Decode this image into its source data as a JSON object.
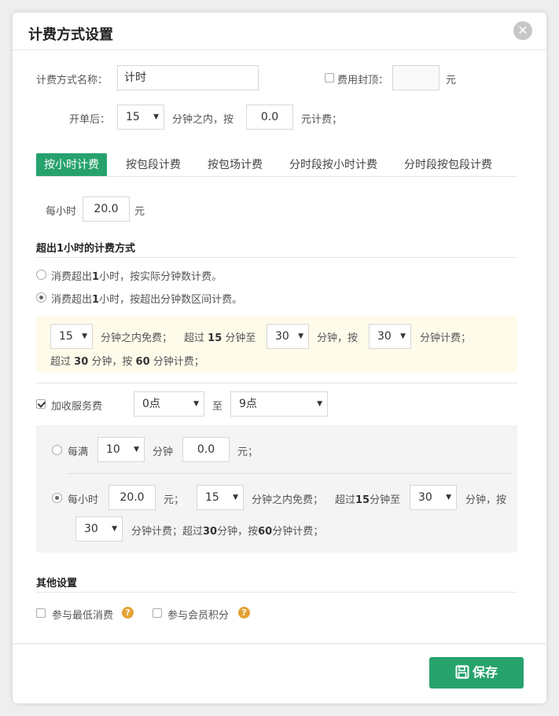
{
  "dialog": {
    "title": "计费方式设置",
    "close_icon": "✕"
  },
  "form": {
    "name_label": "计费方式名称：",
    "name_value": "计时",
    "cap_label": "费用封顶：",
    "cap_value": "",
    "cap_unit": "元",
    "cap_checked": false,
    "open_label": "开单后：",
    "open_minutes": "15",
    "open_within": "分钟之内，按",
    "open_fee": "0.0",
    "open_unit": "元计费；"
  },
  "tabs": [
    {
      "label": "按小时计费",
      "active": true
    },
    {
      "label": "按包段计费",
      "active": false
    },
    {
      "label": "按包场计费",
      "active": false
    },
    {
      "label": "分时段按小时计费",
      "active": false
    },
    {
      "label": "分时段按包段计费",
      "active": false
    }
  ],
  "hourly": {
    "label": "每小时",
    "value": "20.0",
    "unit": "元"
  },
  "overtime": {
    "title": "超出1小时的计费方式",
    "option1": {
      "pre": "消费超出",
      "num": "1",
      "post": "小时，按实际分钟数计费。",
      "selected": false
    },
    "option2": {
      "pre": "消费超出",
      "num": "1",
      "post": "小时，按超出分钟数区间计费。",
      "selected": true
    },
    "box": {
      "free_minutes": "15",
      "free_text": "分钟之内免费；",
      "over_pre": "超过",
      "over_num": "15",
      "over_mid": "分钟至",
      "to_minutes": "30",
      "per_text": "分钟，按",
      "charge_minutes": "30",
      "charge_text": "分钟计费；",
      "line2_pre": "超过",
      "line2_num1": "30",
      "line2_mid": "分钟，按",
      "line2_num2": "60",
      "line2_post": "分钟计费；"
    }
  },
  "service": {
    "checked": true,
    "label": "加收服务费",
    "from": "0点",
    "to_label": "至",
    "to": "9点",
    "mode1": {
      "label": "每满",
      "minutes": "10",
      "minutes_unit": "分钟",
      "fee": "0.0",
      "fee_unit": "元；",
      "selected": false
    },
    "mode2": {
      "label": "每小时",
      "fee": "20.0",
      "fee_unit": "元；",
      "free_minutes": "15",
      "free_text": "分钟之内免费；",
      "over_pre": "超过",
      "over_num": "15",
      "over_mid": "分钟至",
      "to_minutes": "30",
      "per_text": "分钟，按",
      "charge_minutes": "30",
      "charge_text": "分钟计费；超过",
      "line2_num1": "30",
      "line2_mid": "分钟，按",
      "line2_num2": "60",
      "line2_post": "分钟计费；",
      "selected": true
    }
  },
  "other": {
    "title": "其他设置",
    "min_consume": {
      "label": "参与最低消费",
      "checked": false
    },
    "member_points": {
      "label": "参与会员积分",
      "checked": false
    },
    "help_glyph": "?"
  },
  "footer": {
    "save_label": "保存",
    "save_icon": "floppy-disk-icon"
  },
  "colors": {
    "accent": "#27a26d",
    "help": "#e4a235",
    "note_bg": "#fffbea",
    "panel_bg": "#f4f4f4"
  }
}
